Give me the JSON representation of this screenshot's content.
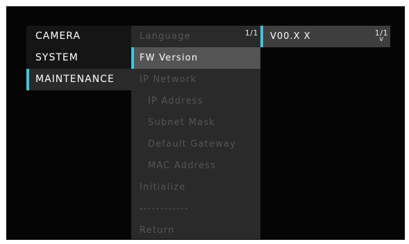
{
  "main_menu": {
    "items": [
      {
        "label": "CAMERA"
      },
      {
        "label": "SYSTEM"
      },
      {
        "label": "MAINTENANCE"
      }
    ],
    "active_index": 2
  },
  "sub_menu": {
    "page": "1/1",
    "items": [
      {
        "label": "Language",
        "enabled": false
      },
      {
        "label": "FW Version",
        "enabled": true,
        "selected": true
      },
      {
        "label": "IP Network",
        "enabled": false
      },
      {
        "label": "IP Address",
        "enabled": false
      },
      {
        "label": "Subnet Mask",
        "enabled": false
      },
      {
        "label": "Default Gateway",
        "enabled": false
      },
      {
        "label": "MAC Address",
        "enabled": false
      },
      {
        "label": "Initialize",
        "enabled": false
      },
      {
        "label": "------------",
        "enabled": false
      },
      {
        "label": "Return",
        "enabled": false
      }
    ]
  },
  "value_panel": {
    "value": "V00.X X",
    "page": "1/1",
    "scroll_arrow": "v"
  },
  "colors": {
    "accent": "#3ec6e0",
    "background": "#050505",
    "panel": "#2a2a2a",
    "selected_row": "#545454",
    "disabled_text": "#555555"
  }
}
